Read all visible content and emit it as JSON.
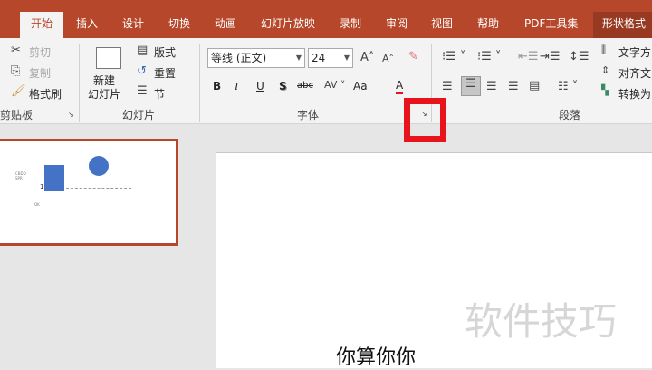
{
  "tabs": [
    "开始",
    "插入",
    "设计",
    "切换",
    "动画",
    "幻灯片放映",
    "录制",
    "审阅",
    "视图",
    "帮助",
    "PDF工具集",
    "形状格式"
  ],
  "active_tab": "开始",
  "clipboard": {
    "cut": "剪切",
    "copy": "复制",
    "format_painter": "格式刷",
    "label": "剪贴板"
  },
  "slides": {
    "new_slide": "新建\n幻灯片",
    "layout": "版式",
    "reset": "重置",
    "section": "节",
    "label": "幻灯片"
  },
  "font": {
    "name": "等线 (正文)",
    "size": "24",
    "label": "字体",
    "bold": "B",
    "italic": "I",
    "underline": "U",
    "shadow": "S",
    "strike": "abc",
    "case": "Aa",
    "color_letter": "A",
    "color_bar": "#e8141c"
  },
  "paragraph": {
    "label": "段落",
    "text_direction": "文字方",
    "align_text": "对齐文",
    "convert": "转换为"
  },
  "thumbnail": {
    "number": "1",
    "text1": "CBDD",
    "text2": "SPR",
    "text3": "OK",
    "shape_color": "#4472c4"
  },
  "slide": {
    "text": "你算你你",
    "watermark": "软件技巧"
  },
  "colors": {
    "accent": "#b7472a",
    "highlight": "#e8141c"
  }
}
